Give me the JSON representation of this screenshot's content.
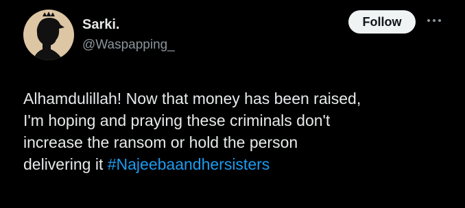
{
  "author": {
    "display_name": "Sarki.",
    "handle": "@Waspapping_"
  },
  "actions": {
    "follow_label": "Follow",
    "more_icon": "more-horizontal-icon"
  },
  "tweet": {
    "lines": [
      "Alhamdulillah! Now that money has been raised,",
      "I'm hoping and praying these criminals don't",
      "increase the ransom or hold the person"
    ],
    "last_line_prefix": "delivering it ",
    "hashtag": "#Najeebaandhersisters"
  },
  "colors": {
    "background": "#000000",
    "text": "#e7e9ea",
    "secondary_text": "#8b949a",
    "link": "#1d9bf0",
    "follow_button_bg": "#eff3f4",
    "avatar_bg": "#ddc6a4"
  }
}
